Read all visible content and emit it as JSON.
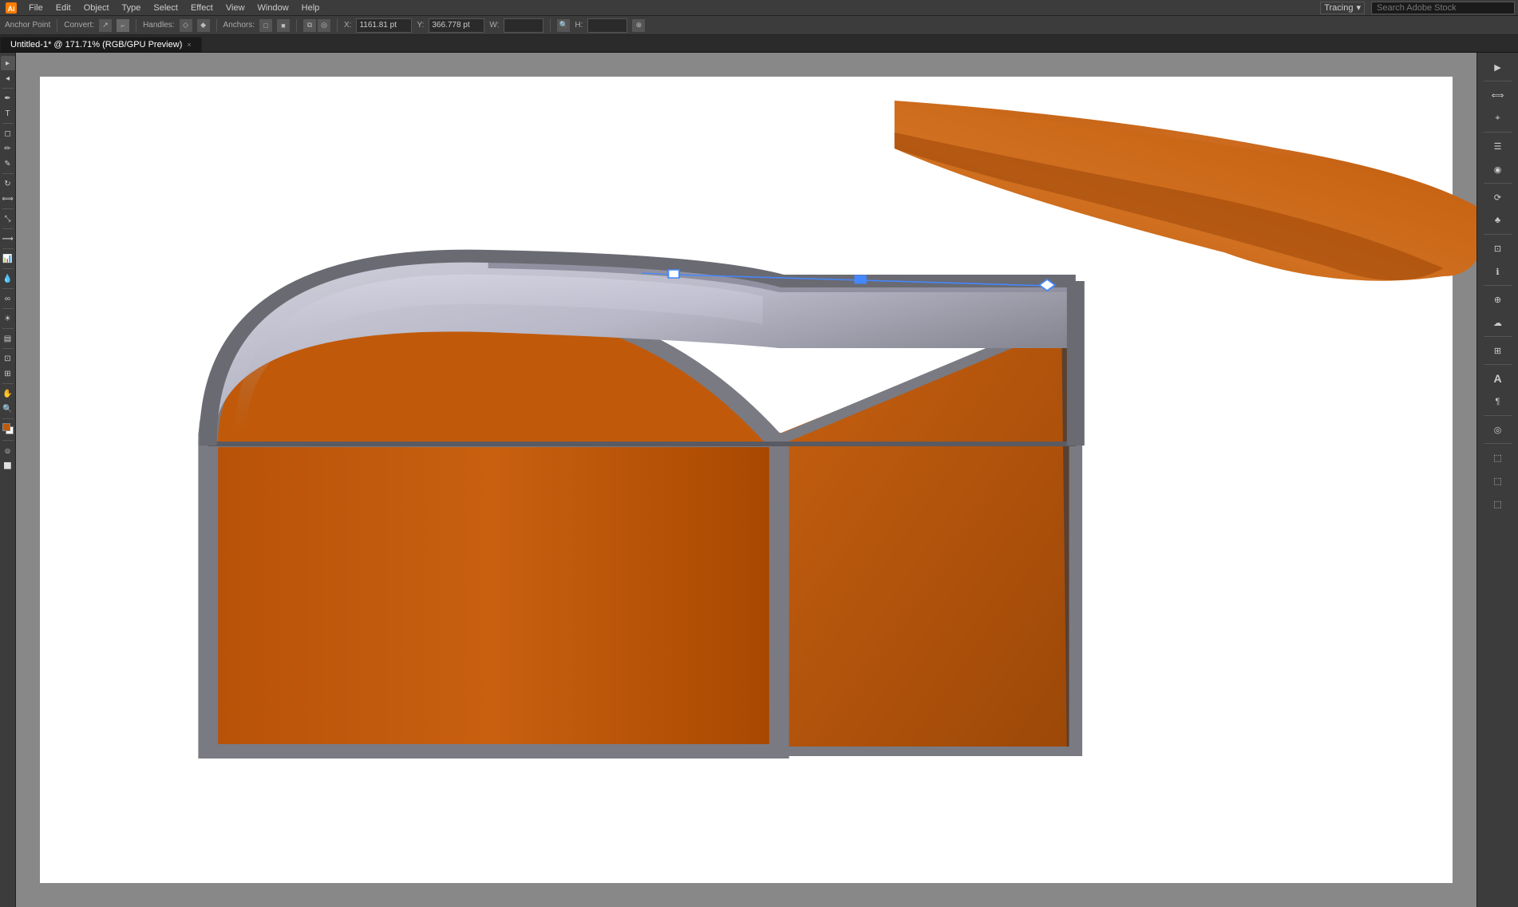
{
  "menubar": {
    "items": [
      "File",
      "Edit",
      "Object",
      "Type",
      "Select",
      "Effect",
      "View",
      "Window",
      "Help"
    ],
    "workspace_dropdown": "Tracing",
    "search_placeholder": "Search Adobe Stock"
  },
  "optionsbar": {
    "anchor_point_label": "Anchor Point",
    "convert_label": "Convert:",
    "handles_label": "Handles:",
    "anchors_label": "Anchors:",
    "x_label": "X:",
    "x_value": "1161.81 pt",
    "y_label": "Y:",
    "y_value": "366.778 pt",
    "w_label": "W:",
    "w_value": ""
  },
  "tab": {
    "title": "Untitled-1* @ 171.71% (RGB/GPU Preview)",
    "close": "×"
  },
  "tools": {
    "items": [
      "▸",
      "◻",
      "✒",
      "T",
      "◎",
      "☰",
      "⟨",
      "✧",
      "⤡",
      "⊘",
      "⊕",
      "⊗"
    ]
  },
  "right_panel": {
    "items": [
      "▶",
      "⟺",
      "⌖",
      "☰",
      "◉",
      "⟳",
      "♣",
      "⊡",
      "ℹ",
      "⊕",
      "☁",
      "⊞",
      "A",
      "¶",
      "◎",
      "⊞",
      "⬚",
      "⬚",
      "⬚"
    ]
  },
  "colors": {
    "orange": "#c05a0a",
    "orange_light": "#d4722a",
    "orange_dark": "#9c4808",
    "gray_dark": "#6a6a72",
    "gray_mid": "#8c8c96",
    "gray_light": "#b0b0be",
    "highlight": "#d8d8e8"
  },
  "canvas": {
    "zoom": "171.71%",
    "mode": "RGB/GPU Preview"
  }
}
